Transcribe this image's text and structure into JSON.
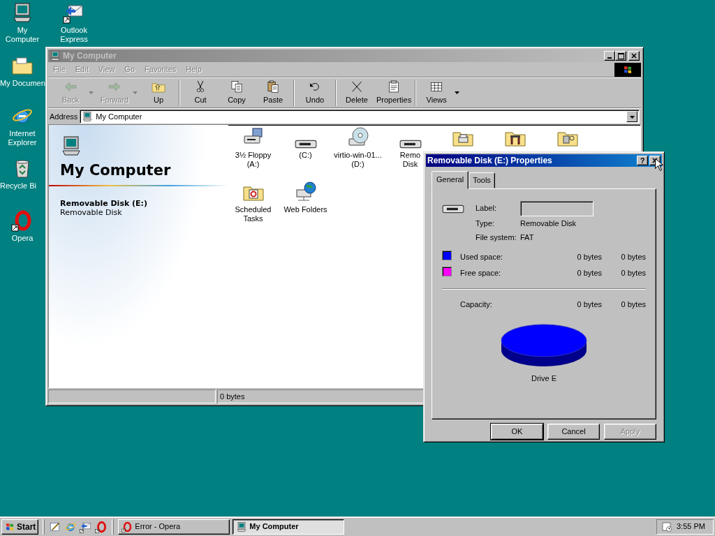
{
  "desktop_icons": [
    {
      "kind": "computer",
      "label": "My Computer"
    },
    {
      "kind": "mail",
      "label": "Outlook Express"
    },
    {
      "kind": "folder",
      "label": "My Documen"
    },
    {
      "kind": "ie",
      "label": "Internet Explorer"
    },
    {
      "kind": "recycle",
      "label": "Recycle Bi"
    },
    {
      "kind": "opera",
      "label": "Opera"
    }
  ],
  "explorer": {
    "title": "My Computer",
    "active": false,
    "menu": [
      "File",
      "Edit",
      "View",
      "Go",
      "Favorites",
      "Help"
    ],
    "toolbar": [
      {
        "kind": "back",
        "label": "Back",
        "disabled": true,
        "dropdown": true
      },
      {
        "kind": "forward",
        "label": "Forward",
        "disabled": true,
        "dropdown": true
      },
      {
        "kind": "up",
        "label": "Up",
        "disabled": false,
        "dropdown": false
      },
      {
        "kind": "separator"
      },
      {
        "kind": "cut",
        "label": "Cut",
        "disabled": false,
        "dropdown": false
      },
      {
        "kind": "copy",
        "label": "Copy",
        "disabled": false,
        "dropdown": false
      },
      {
        "kind": "paste",
        "label": "Paste",
        "disabled": false,
        "dropdown": false
      },
      {
        "kind": "separator"
      },
      {
        "kind": "undo",
        "label": "Undo",
        "disabled": false,
        "dropdown": false
      },
      {
        "kind": "separator"
      },
      {
        "kind": "delete",
        "label": "Delete",
        "disabled": false,
        "dropdown": false
      },
      {
        "kind": "properties",
        "label": "Properties",
        "disabled": false,
        "dropdown": false
      },
      {
        "kind": "separator"
      },
      {
        "kind": "views",
        "label": "Views",
        "disabled": false,
        "dropdown": true
      }
    ],
    "address": {
      "label": "Address",
      "value": "My Computer"
    },
    "left_pane": {
      "title": "My Computer",
      "selection_name": "Removable Disk (E:)",
      "selection_type": "Removable Disk"
    },
    "items": [
      {
        "kind": "floppy",
        "label": "3½ Floppy (A:)"
      },
      {
        "kind": "harddisk",
        "label": "(C:)"
      },
      {
        "kind": "cdrom",
        "label": "virtio-win-01... (D:)"
      },
      {
        "kind": "removable",
        "label": "Remo\nDisk"
      },
      {
        "kind": "printers"
      },
      {
        "kind": "controlpanel"
      },
      {
        "kind": "dialup"
      },
      {
        "kind": "scheduled",
        "label": "Scheduled Tasks"
      },
      {
        "kind": "webfolders",
        "label": "Web Folders"
      }
    ],
    "status_bar": {
      "size": "0 bytes"
    }
  },
  "dialog": {
    "title": "Removable Disk (E:) Properties",
    "active": true,
    "help_glyph": "?",
    "tabs": [
      {
        "label": "General",
        "selected": true
      },
      {
        "label": "Tools",
        "selected": false
      }
    ],
    "label_field": {
      "caption": "Label:",
      "disabled": true
    },
    "type": {
      "caption": "Type:",
      "value": "Removable Disk"
    },
    "file_system": {
      "caption": "File system:",
      "value": "FAT"
    },
    "usage": [
      {
        "caption": "Used space:",
        "color": "#0000ff",
        "bytes": "0 bytes",
        "size": "0 bytes"
      },
      {
        "caption": "Free space:",
        "color": "#ff00ff",
        "bytes": "0 bytes",
        "size": "0 bytes"
      }
    ],
    "capacity": {
      "caption": "Capacity:",
      "bytes": "0 bytes",
      "size": "0 bytes"
    },
    "drive_caption": "Drive E",
    "buttons": [
      {
        "label": "OK",
        "disabled": false,
        "default": true
      },
      {
        "label": "Cancel",
        "disabled": false,
        "default": false
      },
      {
        "label": "Apply",
        "disabled": true,
        "default": false
      }
    ]
  },
  "taskbar": {
    "start": "Start",
    "quick_launch": [
      {
        "kind": "desktop"
      },
      {
        "kind": "ie"
      },
      {
        "kind": "mail"
      },
      {
        "kind": "opera"
      }
    ],
    "tasks": [
      {
        "kind": "opera",
        "label": "Error - Opera",
        "selected": false
      },
      {
        "kind": "computer",
        "label": "My Computer",
        "selected": true
      }
    ],
    "clock": "3:55 PM"
  }
}
